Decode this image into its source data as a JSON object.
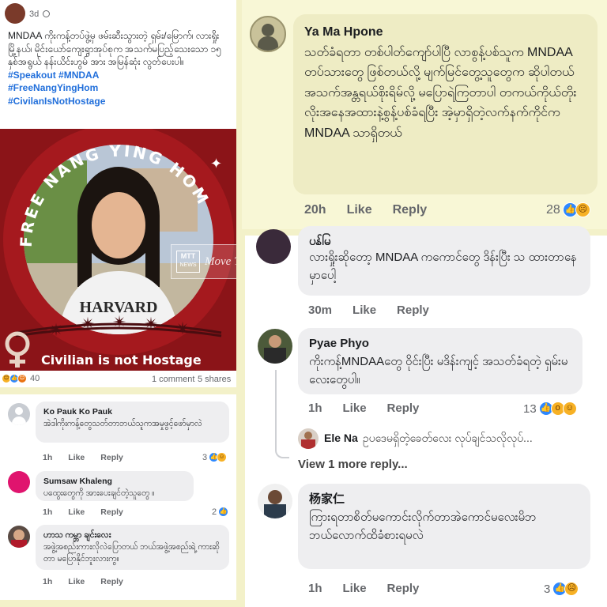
{
  "post": {
    "time": "3d",
    "globe_icon": "globe-icon",
    "body": "MNDAA ကိုးကန့်တပ်ဖွဲ့မှ ဖမ်းဆီးသွားတဲ့ ရှမ်း/မြောက်၊ လားရှိုးမြို့နယ်၊ မိုင်းယော်ကျေးရွာအုပ်စုက အသက်မပြည့်သေးသော ၁၅ နှစ်အရွယ် နန်းယိင်းဟွမ် အား အမြန်ဆုံး လွတ်ပေးပါ။",
    "hashtags": [
      "#Speakout #MNDAA",
      "#FreeNangYingHom",
      "#CivilanIsNotHostage"
    ],
    "poster_title": "FREE NANG YING HOM",
    "poster_footer": "Civilian is not Hostage",
    "shirt_text": "HARVARD",
    "watermark": "Move To Truth",
    "watermark_logo": "MTT",
    "watermark_logo_sub": "NEWS",
    "reaction_count": "40",
    "comments_count": "1 comment",
    "shares_count": "5 shares"
  },
  "left_comments": [
    {
      "name": "Ko Pauk Ko Pauk",
      "text": "အဲဒါကိုးကန့်တွေသတ်တာဘယ်သူကအမှုဖွင့်ဖော်မှာလဲ",
      "time": "1h",
      "like_label": "Like",
      "reply_label": "Reply",
      "reaction_count": "3"
    },
    {
      "name": "Sumsaw Khaleng",
      "text": "ပထွေးတွေကို အားပေးချင်တဲ့သူတွေ ။",
      "time": "1h",
      "like_label": "Like",
      "reply_label": "Reply",
      "reaction_count": "2"
    },
    {
      "name": "ဟာသ ကမ္ဘာ ချင်းလေး",
      "text": "အဖွဲ့အစည်းကားလိုလဲပြောတယ် ဘယ်အဖွဲ့အစည်းရဲ့ ကားဆိုတာ မပြောနိုင်ဘူးလားကွ။",
      "time": "1h",
      "like_label": "Like",
      "reply_label": "Reply",
      "reaction_count": ""
    }
  ],
  "top_comment": {
    "name": "Ya Ma Hpone",
    "text": "သတ်ခံရတာ တစ်ပါတ်ကျော်ပါပြီ လာစွန့်ပစ်သူက MNDAA တပ်သားတွေ ဖြစ်တယ်လို့ မျက်မြင်တွေ့သူတွေက ဆိုပါတယ် အသက်အန္တရယ်စိုးရိမ်လို့ မပြောရဲကြတာပါ တကယ်ကိုယ်တိုးလိုးအနေအထားနဲ့စွန့်ပစ်ခံရပြီး အဲ့မှာရှိတဲ့လက်နက်ကိုင်က MNDAA သာရှိတယ်",
    "time": "20h",
    "like_label": "Like",
    "reply_label": "Reply",
    "reaction_count": "28"
  },
  "right_comments": [
    {
      "name": "ပန်မြ",
      "text": "လားရှိုးဆိုတော့ MNDAA ကကောင်တွေ ဒိန်းပြီး သ ထားတာနေမှာပေါ့",
      "time": "30m",
      "like_label": "Like",
      "reply_label": "Reply",
      "reaction_count": ""
    },
    {
      "name": "Pyae Phyo",
      "text": "ကိုးကန့်MNDAAတွေ ဝိုင်းပြီး မဒိန်းကျင့် အသတ်ခံရတဲ့ ရှမ်းမလေးတွေပါ။",
      "time": "1h",
      "like_label": "Like",
      "reply_label": "Reply",
      "reaction_count": "13"
    },
    {
      "name": "杨家仁",
      "text": "ကြားရတာစိတ်မကောင်းလိုက်တာအဲကောင်မလေးမိဘဘယ်လောက်ထိခံစားရမလဲ",
      "time": "1h",
      "like_label": "Like",
      "reply_label": "Reply",
      "reaction_count": "3"
    }
  ],
  "nested_reply": {
    "name": "Ele Na",
    "text": "ဥပဒေမရှိတဲ့ခေတ်လေး လုပ်ချင်သလိုလုပ်...",
    "view_more": "View 1 more reply..."
  }
}
